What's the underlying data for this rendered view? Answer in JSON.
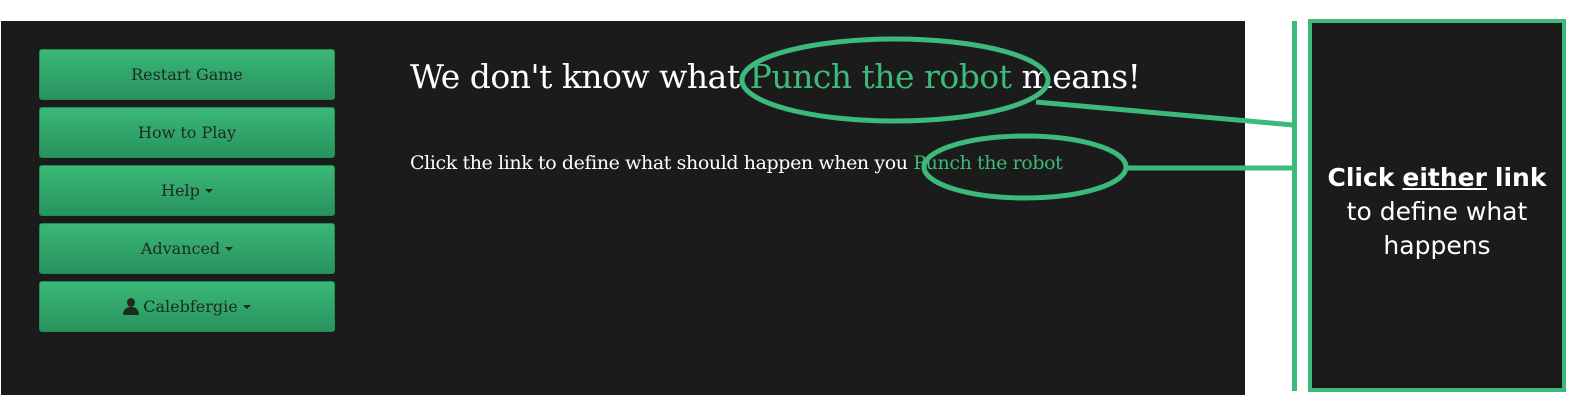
{
  "sidebar": {
    "buttons": [
      {
        "label": "Restart Game"
      },
      {
        "label": "How to Play"
      },
      {
        "label": "Help"
      },
      {
        "label": "Advanced"
      },
      {
        "label": "Calebfergie"
      }
    ]
  },
  "main": {
    "heading_prefix": "We don't know what ",
    "heading_link": "Punch the robot",
    "heading_suffix": " means!",
    "instruction_prefix": "Click the link to define what should happen when you ",
    "instruction_link": "Punch the robot"
  },
  "callout": {
    "word_click": "Click",
    "word_either": "either",
    "word_link": "link",
    "rest": "to define what happens"
  },
  "colors": {
    "accent": "#3dba7a",
    "panel": "#1b1b1b",
    "button": "#2fa96a"
  },
  "icons": {
    "user": "user-icon",
    "caret": "caret-down-icon"
  }
}
